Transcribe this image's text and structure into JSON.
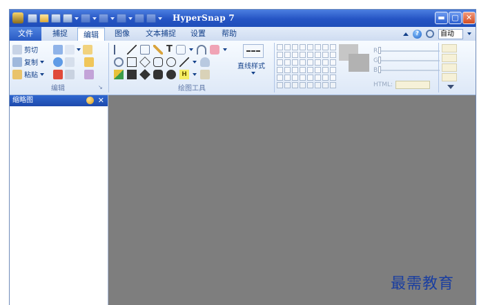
{
  "window": {
    "title": "HyperSnap 7"
  },
  "menu": {
    "tabs": [
      {
        "label": "文件"
      },
      {
        "label": "捕捉"
      },
      {
        "label": "编辑"
      },
      {
        "label": "图像"
      },
      {
        "label": "文本捕捉"
      },
      {
        "label": "设置"
      },
      {
        "label": "帮助"
      }
    ],
    "active_tab": "编辑",
    "zoom_label": "自动"
  },
  "ribbon": {
    "edit_group": {
      "cut_label": "剪切",
      "copy_label": "复制",
      "paste_label": "粘贴",
      "group_label": "编辑"
    },
    "draw_group": {
      "line_style_label": "直线样式",
      "group_label": "绘图工具"
    },
    "color_group": {
      "r_label": "R",
      "g_label": "G",
      "b_label": "B",
      "html_label": "HTML:"
    }
  },
  "panel": {
    "title": "缩略图"
  },
  "watermark": {
    "text": "最需教育"
  },
  "colors": {
    "title_bar": "#2554c4",
    "canvas": "#7e7e7e",
    "menu_text": "#15428b"
  },
  "icons": {
    "window_buttons": [
      "minimize-icon",
      "maximize-icon",
      "close-icon"
    ]
  }
}
